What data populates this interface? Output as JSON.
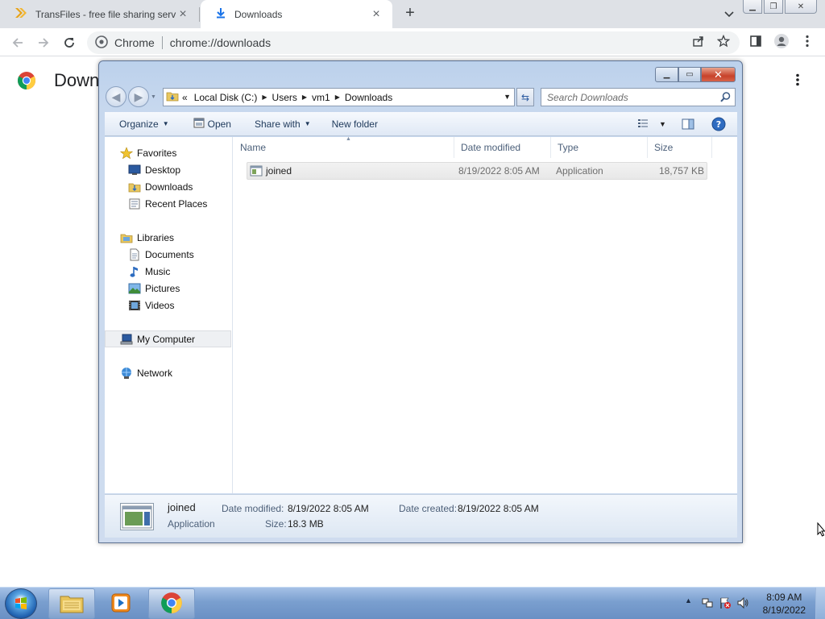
{
  "browser": {
    "tabs": [
      {
        "title": "TransFiles - free file sharing service",
        "icon": "transfiles-chevron-icon",
        "active": false
      },
      {
        "title": "Downloads",
        "icon": "download-icon",
        "active": true
      }
    ],
    "omnibox": {
      "site_label": "Chrome",
      "url": "chrome://downloads"
    },
    "page_title": "Downloads"
  },
  "explorer": {
    "breadcrumbs": [
      "«",
      "Local Disk (C:)",
      "Users",
      "vm1",
      "Downloads"
    ],
    "search_placeholder": "Search Downloads",
    "commands": {
      "organize": "Organize",
      "open": "Open",
      "share_with": "Share with",
      "new_folder": "New folder"
    },
    "nav": {
      "favorites": "Favorites",
      "desktop": "Desktop",
      "downloads": "Downloads",
      "recent_places": "Recent Places",
      "libraries": "Libraries",
      "documents": "Documents",
      "music": "Music",
      "pictures": "Pictures",
      "videos": "Videos",
      "my_computer": "My Computer",
      "network": "Network"
    },
    "columns": {
      "name": "Name",
      "date_modified": "Date modified",
      "type": "Type",
      "size": "Size"
    },
    "files": [
      {
        "name": "joined",
        "date_modified": "8/19/2022 8:05 AM",
        "type": "Application",
        "size": "18,757 KB"
      }
    ],
    "details": {
      "name": "joined",
      "type": "Application",
      "date_modified_label": "Date modified:",
      "date_modified": "8/19/2022 8:05 AM",
      "date_created_label": "Date created:",
      "date_created": "8/19/2022 8:05 AM",
      "size_label": "Size:",
      "size": "18.3 MB"
    }
  },
  "taskbar": {
    "time": "8:09 AM",
    "date": "8/19/2022"
  },
  "colors": {
    "accent": "#1a73e8",
    "taskbar": "#7a9fcf",
    "selection": "#e8e8e8"
  }
}
